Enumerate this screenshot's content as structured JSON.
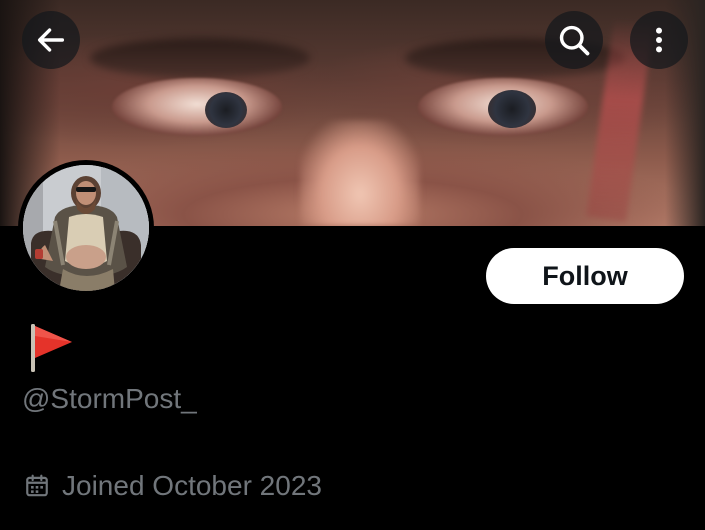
{
  "header": {
    "back_icon": "arrow-left-icon",
    "search_icon": "search-icon",
    "more_icon": "more-vertical-icon"
  },
  "banner": {
    "description_icon": "banner-image"
  },
  "profile": {
    "display_name_icon": "red-triangular-flag-emoji",
    "handle": "@StormPost_",
    "follow_label": "Follow",
    "joined_icon": "calendar-icon",
    "joined_text": "Joined October 2023"
  },
  "colors": {
    "background": "#000000",
    "secondary_text": "#71767b",
    "follow_bg": "#ffffff",
    "follow_text": "#0f1419",
    "flag_red": "#e5332a"
  }
}
